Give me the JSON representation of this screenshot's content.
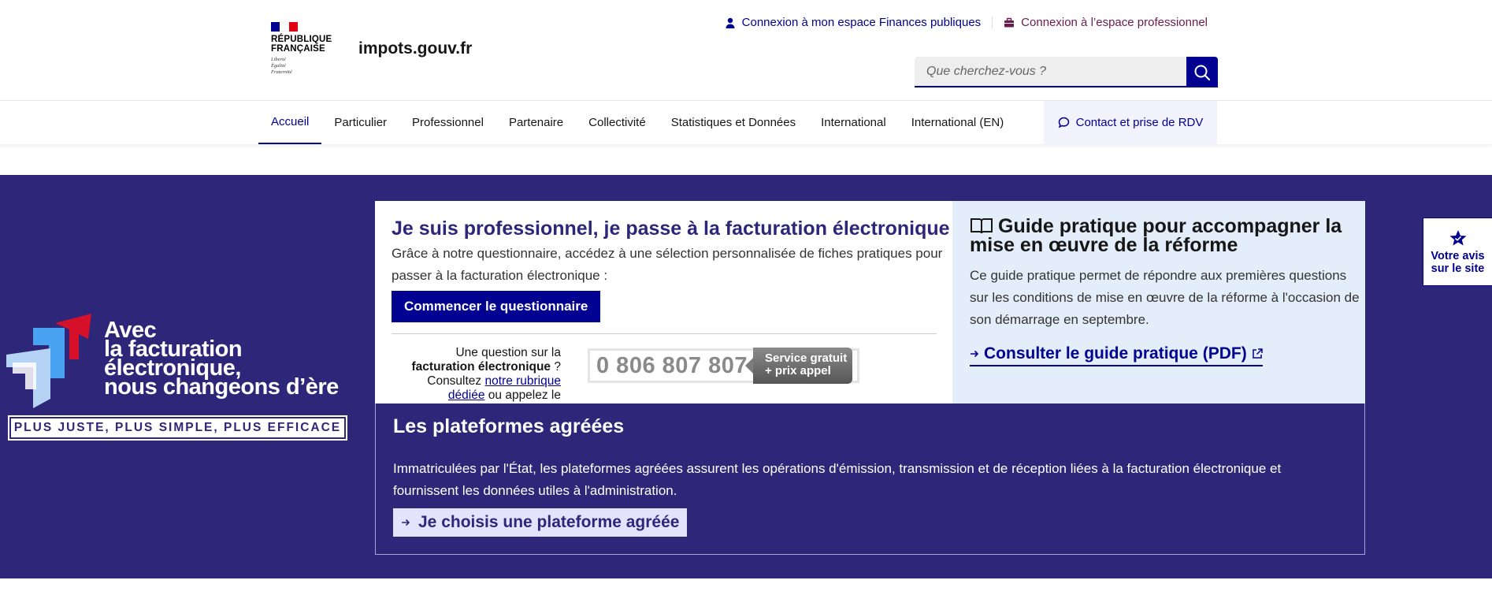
{
  "header": {
    "republique": "RÉPUBLIQUE",
    "francaise": "FRANÇAISE",
    "motto_1": "Liberté",
    "motto_2": "Égalité",
    "motto_3": "Fraternité",
    "site_name": "impots.gouv.fr",
    "link_particulier": "Connexion à mon espace Finances publiques",
    "link_pro": "Connexion à l’espace professionnel",
    "search_placeholder": "Que cherchez-vous ?"
  },
  "nav": {
    "items": [
      "Accueil",
      "Particulier",
      "Professionnel",
      "Partenaire",
      "Collectivité",
      "Statistiques et Données",
      "International",
      "International (EN)"
    ],
    "contact": "Contact et prise de RDV"
  },
  "hero": {
    "line1": "Avec",
    "line2": "la facturation",
    "line3": "électronique,",
    "line4": "nous changeons d’ère",
    "tagline": "PLUS JUSTE, PLUS SIMPLE, PLUS EFFICACE"
  },
  "card_pro": {
    "title": "Je suis professionnel, je passe à la facturation électronique",
    "lead": "Grâce à notre questionnaire, accédez à une sélection personnalisée de fiches pratiques pour passer à la facturation électronique :",
    "button": "Commencer le questionnaire",
    "q_part1": "Une question sur la ",
    "q_bold": "facturation électronique",
    "q_part2": " ? Consultez ",
    "q_link": "notre rubrique dédiée",
    "q_part3": " ou appelez le",
    "phone": "0 806 807 807",
    "phone_tag_1": "Service gratuit",
    "phone_tag_2": "+ prix appel"
  },
  "card_guide": {
    "title": "Guide pratique pour accompagner la mise en œuvre de la réforme",
    "text": "Ce guide pratique permet de répondre aux premières questions sur les conditions de mise en œuvre de la réforme à l'occasion de son démarrage en septembre.",
    "link": "Consulter le guide pratique (PDF)"
  },
  "platforms": {
    "title": "Les plateformes agréées",
    "text": "Immatriculées par l'État, les plateformes agréées assurent les opérations d'émission, transmission et de réception liées à la facturation électronique et fournissent les données utiles à l'administration.",
    "button": "Je choisis une plateforme agréée"
  },
  "feedback": {
    "line1": "Votre avis",
    "line2": "sur le site"
  },
  "colors": {
    "primary": "#000091",
    "banner": "#2e2678",
    "pro_accent": "#6a1b4d",
    "guide_bg": "#e3eefa"
  }
}
